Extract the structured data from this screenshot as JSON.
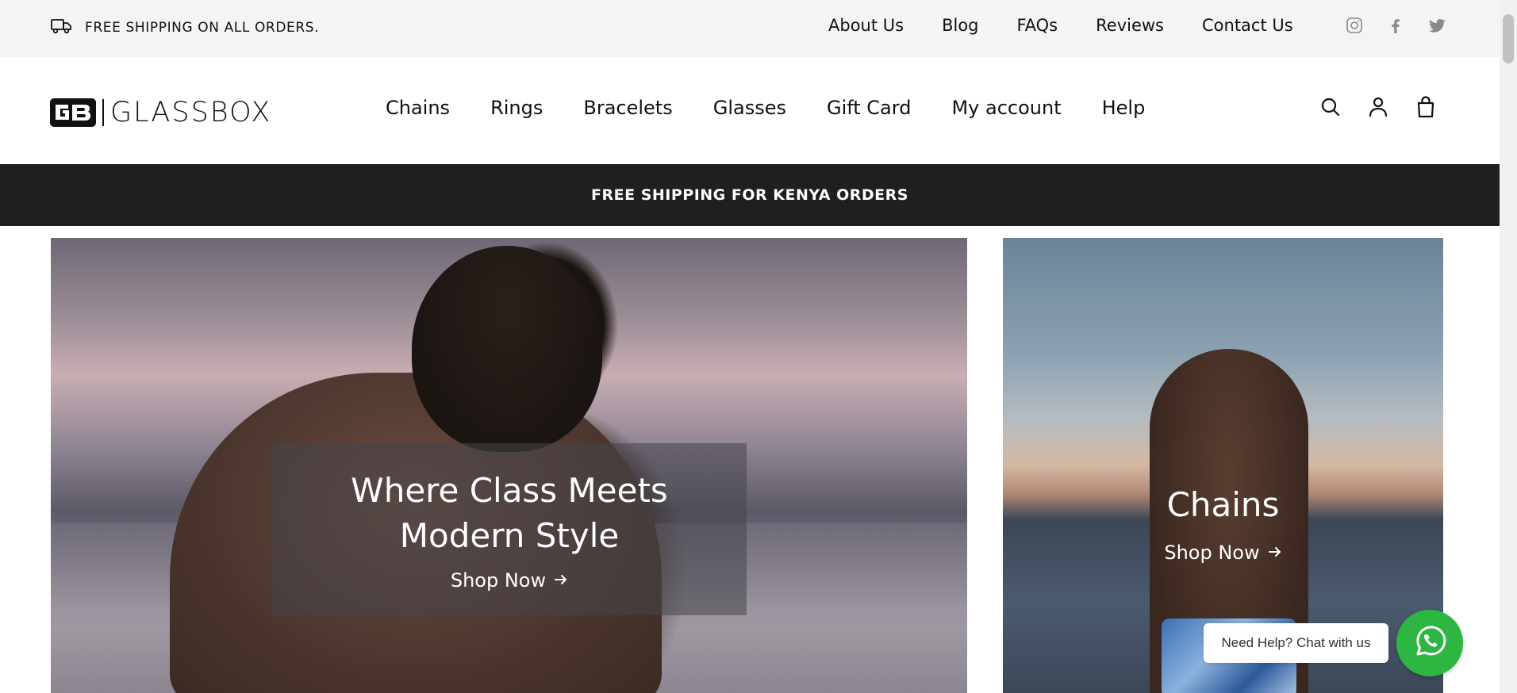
{
  "topbar": {
    "shipping_text": "FREE SHIPPING ON ALL ORDERS.",
    "shipping_icon": "truck-icon",
    "links": [
      {
        "label": "About Us"
      },
      {
        "label": "Blog"
      },
      {
        "label": "FAQs"
      },
      {
        "label": "Reviews"
      },
      {
        "label": "Contact Us"
      }
    ],
    "social": [
      "instagram-icon",
      "facebook-icon",
      "twitter-icon"
    ]
  },
  "header": {
    "logo_text": "GLASSBOX",
    "logo_mark": "GB",
    "nav": [
      {
        "label": "Chains"
      },
      {
        "label": "Rings"
      },
      {
        "label": "Bracelets"
      },
      {
        "label": "Glasses"
      },
      {
        "label": "Gift Card"
      },
      {
        "label": "My account"
      },
      {
        "label": "Help"
      }
    ],
    "icons": [
      "search-icon",
      "account-icon",
      "cart-bag-icon"
    ]
  },
  "promo": {
    "text": "FREE SHIPPING FOR KENYA ORDERS"
  },
  "hero": {
    "main": {
      "title": "Where Class Meets Modern Style",
      "cta": "Shop Now"
    },
    "side": {
      "title": "Chains",
      "cta": "Shop Now"
    }
  },
  "whatsapp": {
    "bubble_text": "Need Help? Chat with us",
    "icon": "whatsapp-icon"
  },
  "colors": {
    "topbar_bg": "#f4f4f4",
    "promo_bg": "#1f1f1f",
    "whatsapp_green": "#2db742"
  }
}
